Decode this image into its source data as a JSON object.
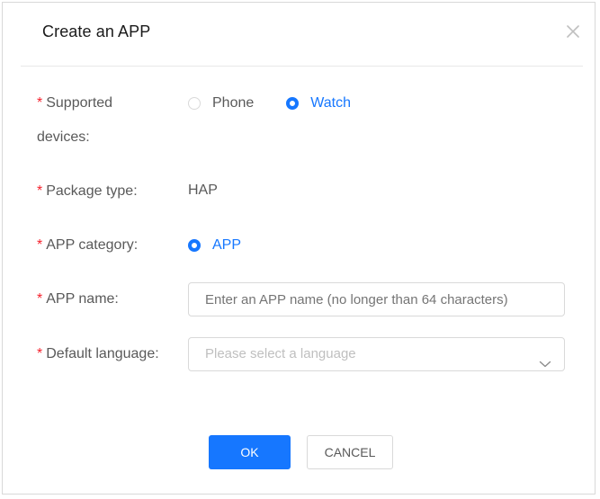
{
  "dialog": {
    "title": "Create an APP"
  },
  "form": {
    "required_mark": "*",
    "devices": {
      "label_line1": "Supported",
      "label_line2": "devices:",
      "options": [
        {
          "label": "Phone",
          "selected": false
        },
        {
          "label": "Watch",
          "selected": true
        }
      ]
    },
    "package_type": {
      "label": "Package type:",
      "value": "HAP"
    },
    "category": {
      "label": "APP category:",
      "options": [
        {
          "label": "APP",
          "selected": true
        }
      ]
    },
    "app_name": {
      "label": "APP name:",
      "value": "",
      "placeholder": "Enter an APP name (no longer than 64 characters)"
    },
    "language": {
      "label": "Default language:",
      "placeholder": "Please select a language"
    }
  },
  "footer": {
    "ok_label": "OK",
    "cancel_label": "CANCEL"
  },
  "colors": {
    "accent": "#1677ff",
    "required": "#f5222d",
    "border": "#d9d9d9",
    "label_text": "#595959",
    "placeholder": "#bfbfbf"
  },
  "icons": {
    "close": "close-icon",
    "select_arrow": "chevron-down-icon"
  }
}
